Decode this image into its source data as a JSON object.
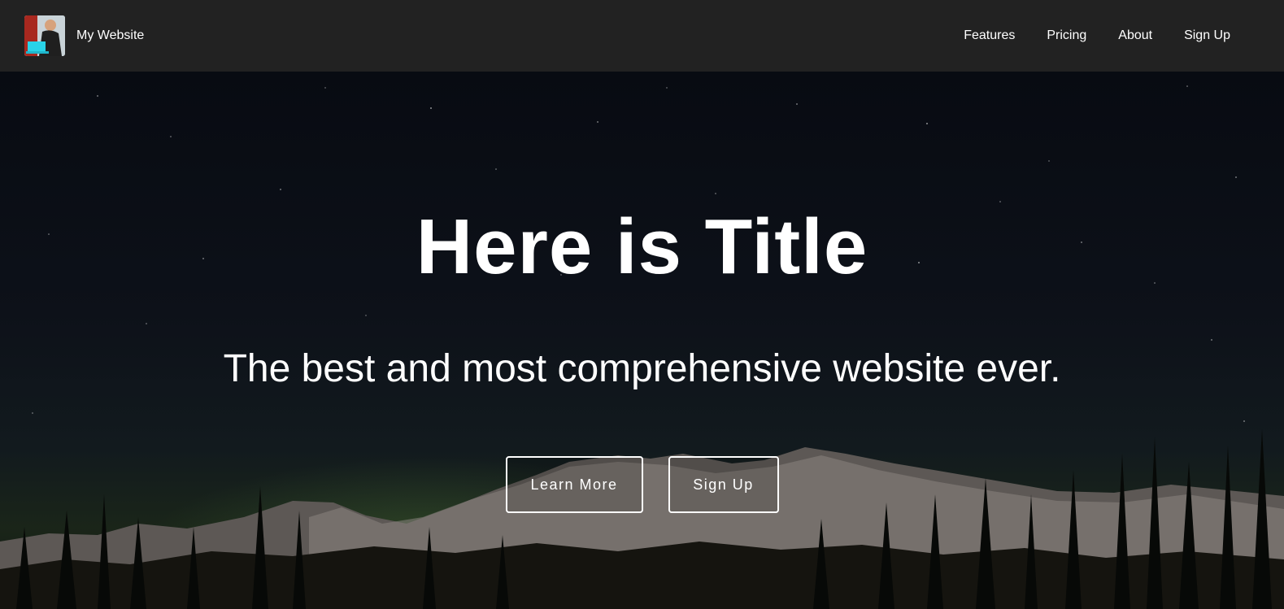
{
  "navbar": {
    "brand": "My Website",
    "links": [
      "Features",
      "Pricing",
      "About",
      "Sign Up"
    ]
  },
  "hero": {
    "title": "Here is Title",
    "subtitle": "The best and most comprehensive website ever.",
    "buttons": {
      "learn_more": "Learn More",
      "sign_up": "Sign Up"
    }
  },
  "icons": {
    "logo": "profile-avatar-icon"
  },
  "colors": {
    "navbar_bg": "#222222",
    "text": "#ffffff",
    "hero_sky": "#0b0e14"
  }
}
